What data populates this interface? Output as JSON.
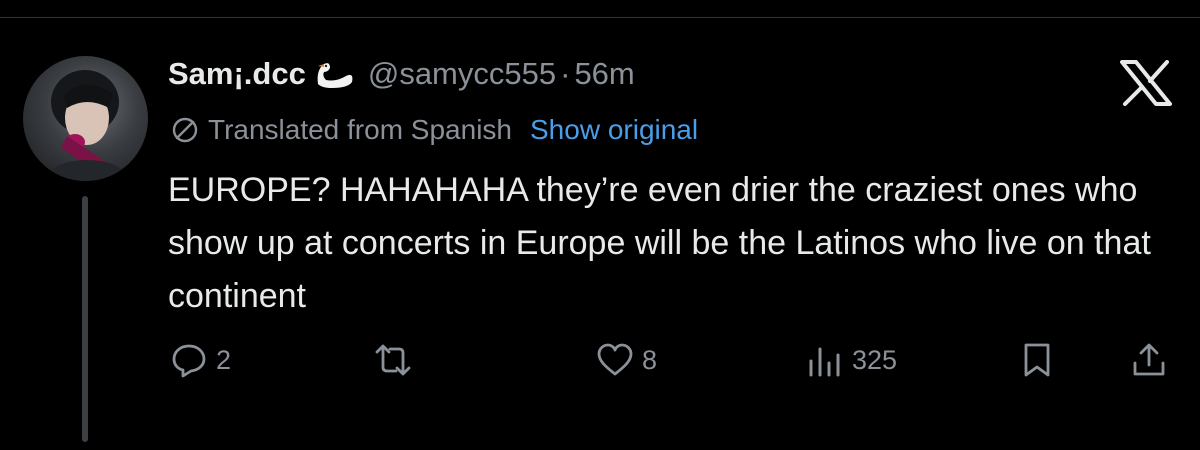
{
  "tweet": {
    "display_name": "Sam¡.dcc",
    "handle": "@samycc555",
    "separator": "·",
    "time": "56m",
    "translation_label": "Translated from Spanish",
    "show_original": "Show original",
    "text": "EUROPE? HAHAHAHA they’re even drier the craziest ones who show up at concerts in Europe will be the Latinos who live on that continent"
  },
  "metrics": {
    "replies": "2",
    "likes": "8",
    "views": "325"
  },
  "icons": {
    "name_emoji": "swan-emoji",
    "platform": "x-logo-icon",
    "translate": "globe-icon",
    "reply": "reply-icon",
    "retweet": "retweet-icon",
    "like": "heart-icon",
    "views": "views-chart-icon",
    "bookmark": "bookmark-icon",
    "share": "share-icon"
  },
  "colors": {
    "background": "#000000",
    "text": "#e7e9ea",
    "muted": "#8b9198",
    "link": "#4a9ee8"
  }
}
